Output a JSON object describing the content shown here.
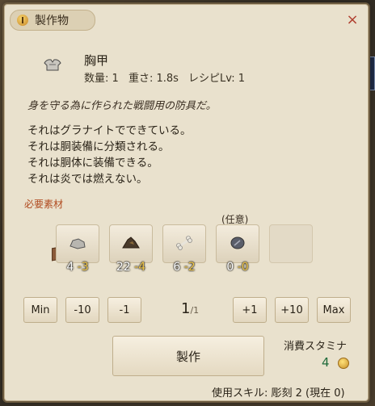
{
  "window": {
    "title": "製作物",
    "close": "×",
    "icons": {
      "title": "pin-icon",
      "close": "close-icon"
    }
  },
  "item": {
    "icon": "breastplate-icon",
    "name": "胸甲",
    "quantity": "数量: 1",
    "weight": "重さ: 1.8s",
    "recipe_level": "レシピLv: 1",
    "description": "身を守る為に作られた戦闘用の防具だ。",
    "properties": [
      "それはグラナイトでできている。",
      "それは胴装備に分類される。",
      "それは胴体に装備できる。",
      "それは炎では燃えない。"
    ]
  },
  "materials": {
    "label": "必要素材",
    "optional_label": "(任意)",
    "box_icon": "box-icon",
    "slots": [
      {
        "icon": "granite-icon",
        "have": "4",
        "need": "-3"
      },
      {
        "icon": "ore-icon",
        "have": "22",
        "need": "-4"
      },
      {
        "icon": "bone-icon",
        "have": "6",
        "need": "-2"
      },
      {
        "icon": "gem-icon",
        "have": "0",
        "need": "-0"
      },
      {
        "icon": "",
        "have": "",
        "need": ""
      }
    ]
  },
  "quantity_controls": {
    "min": "Min",
    "minus10": "-10",
    "minus1": "-1",
    "current": "1",
    "total": "/1",
    "plus1": "+1",
    "plus10": "+10",
    "max": "Max"
  },
  "craft": {
    "button": "製作",
    "stamina_label": "消費スタミナ",
    "stamina_value": "4",
    "stamina_icon": "coin-icon",
    "skill": "使用スキル: 彫刻 2 (現在 0)"
  }
}
